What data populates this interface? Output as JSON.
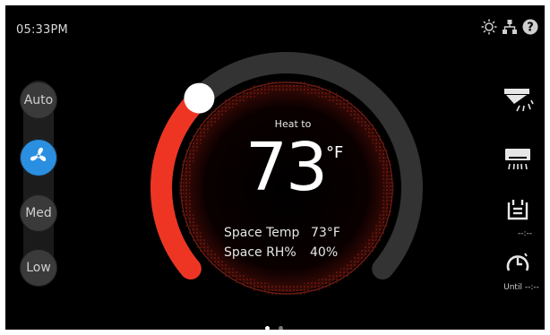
{
  "status": {
    "time": "05:33PM"
  },
  "top_icons": [
    "sun-settings-icon",
    "network-icon",
    "help-icon"
  ],
  "fan_modes": [
    {
      "label": "Auto",
      "active": false
    },
    {
      "label": "",
      "icon": "fan-icon",
      "active": true
    },
    {
      "label": "Med",
      "active": false
    },
    {
      "label": "Low",
      "active": false
    }
  ],
  "dial": {
    "mode_label": "Heat to",
    "setpoint": "73",
    "unit": "°F",
    "setpoint_fraction": 0.33,
    "heat_color": "#ee3524",
    "track_color": "#333333"
  },
  "readings": {
    "space_temp_label": "Space Temp",
    "space_temp_value": "73°F",
    "space_rh_label": "Space RH%",
    "space_rh_value": "40%"
  },
  "right_panel": {
    "items": [
      {
        "icon": "vent-airflow-icon"
      },
      {
        "icon": "ac-unit-icon"
      },
      {
        "icon": "schedule-icon",
        "label": "--:--"
      },
      {
        "icon": "timer-icon",
        "label": "Until --:--"
      }
    ]
  },
  "pager": {
    "pages": 2,
    "active": 0
  }
}
